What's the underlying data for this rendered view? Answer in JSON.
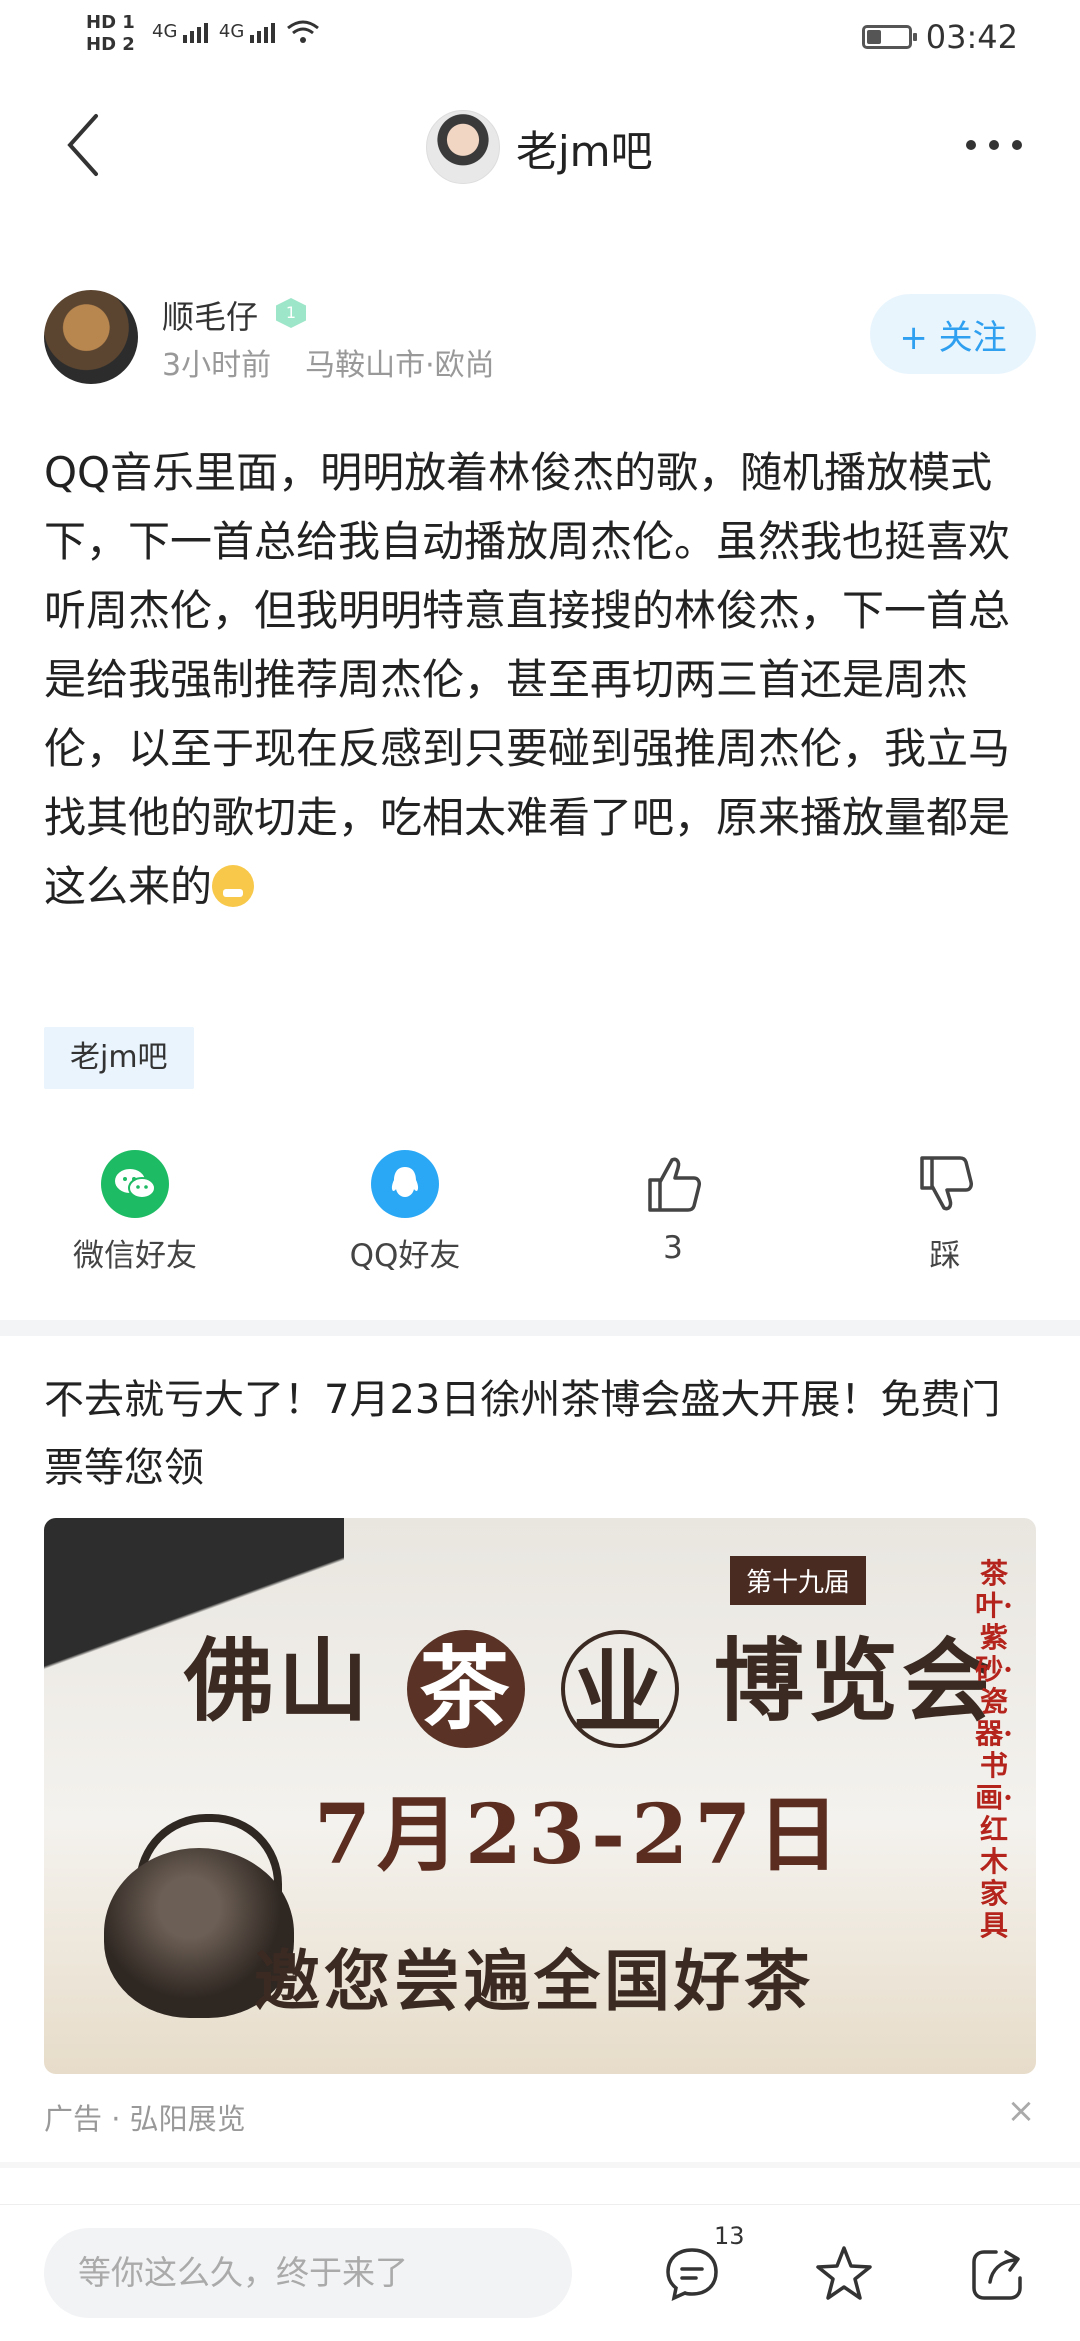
{
  "status_bar": {
    "hd1": "HD 1",
    "hd2": "HD 2",
    "signal1": "4G",
    "signal2": "4G",
    "time": "03:42"
  },
  "header": {
    "title": "老jm吧"
  },
  "post": {
    "author": "顺毛仔",
    "level": "1",
    "time_ago": "3小时前",
    "location": "马鞍山市·欧尚",
    "follow_label": "+ 关注",
    "content": "QQ音乐里面，明明放着林俊杰的歌，随机播放模式下，下一首总给我自动播放周杰伦。虽然我也挺喜欢听周杰伦，但我明明特意直接搜的林俊杰，下一首总是给我强制推荐周杰伦，甚至再切两三首还是周杰伦，以至于现在反感到只要碰到强推周杰伦，我立马找其他的歌切走，吃相太难看了吧，原来播放量都是这么来的",
    "tag": "老jm吧"
  },
  "share": {
    "wechat_label": "微信好友",
    "qq_label": "QQ好友",
    "like_count": "3",
    "dislike_label": "踩"
  },
  "ad": {
    "title": "不去就亏大了！7月23日徐州茶博会盛大开展！免费门票等您领",
    "image": {
      "issue": "第十九届",
      "char_fo": "佛",
      "char_shan": "山",
      "char_cha": "茶",
      "char_ye": "业",
      "rest": "博览会",
      "dates": "7月23-27日",
      "slogan": "邀您尝遍全国好茶",
      "side": "茶叶·紫砂·瓷器·书画·红木家具"
    },
    "source": "广告 · 弘阳展览"
  },
  "bottom_bar": {
    "comment_placeholder": "等你这么久，终于来了",
    "comment_count": "13"
  },
  "colors": {
    "accent": "#2f9ff0",
    "wechat": "#1dbb63",
    "qq": "#2aa8f5"
  }
}
